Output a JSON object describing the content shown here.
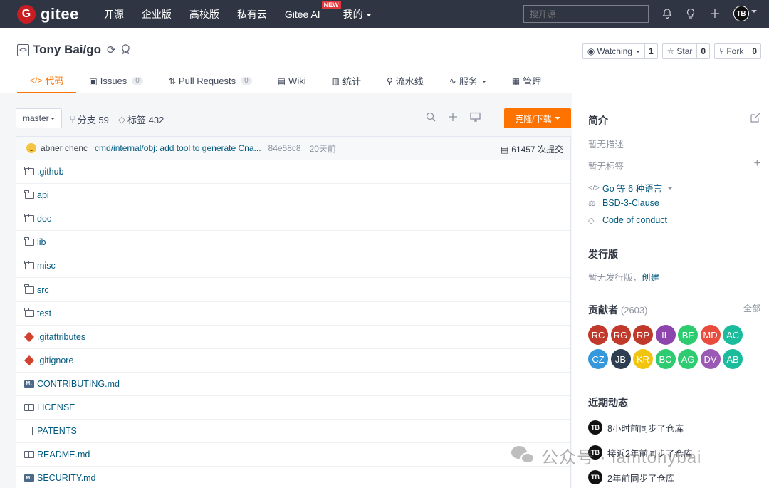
{
  "topnav": {
    "logo_mark": "G",
    "logo_text": "gitee",
    "items": [
      "开源",
      "企业版",
      "高校版",
      "私有云",
      "Gitee AI"
    ],
    "new_badge": "NEW",
    "mine": "我的",
    "search_placeholder": "搜开源",
    "avatar": "TB"
  },
  "repo": {
    "name": "Tony Bai/go",
    "watch_label": "Watching",
    "watch_count": "1",
    "star_label": "Star",
    "star_count": "0",
    "fork_label": "Fork",
    "fork_count": "0"
  },
  "tabs": {
    "code": "代码",
    "issues": "Issues",
    "issues_count": "0",
    "pulls": "Pull Requests",
    "pulls_count": "0",
    "wiki": "Wiki",
    "stats": "统计",
    "pipeline": "流水线",
    "services": "服务",
    "manage": "管理"
  },
  "toolbar": {
    "branch": "master",
    "branches": "分支 59",
    "tags": "标签 432",
    "clone": "克隆/下载"
  },
  "commit": {
    "author": "abner chenc",
    "message": "cmd/internal/obj: add tool to generate Cna...",
    "hash": "84e58c8",
    "time": "20天前",
    "count": "61457 次提交"
  },
  "files": [
    {
      "name": ".github",
      "type": "folder"
    },
    {
      "name": "api",
      "type": "folder"
    },
    {
      "name": "doc",
      "type": "folder"
    },
    {
      "name": "lib",
      "type": "folder"
    },
    {
      "name": "misc",
      "type": "folder"
    },
    {
      "name": "src",
      "type": "folder"
    },
    {
      "name": "test",
      "type": "folder"
    },
    {
      "name": ".gitattributes",
      "type": "git"
    },
    {
      "name": ".gitignore",
      "type": "git"
    },
    {
      "name": "CONTRIBUTING.md",
      "type": "md"
    },
    {
      "name": "LICENSE",
      "type": "book"
    },
    {
      "name": "PATENTS",
      "type": "doc"
    },
    {
      "name": "README.md",
      "type": "book"
    },
    {
      "name": "SECURITY.md",
      "type": "md"
    }
  ],
  "sidebar": {
    "intro_title": "简介",
    "no_desc": "暂无描述",
    "no_tags": "暂无标签",
    "language": "Go 等 6 种语言",
    "license": "BSD-3-Clause",
    "conduct": "Code of conduct",
    "release_title": "发行版",
    "no_release": "暂无发行版，",
    "create": "创建",
    "contrib_title": "贡献者",
    "contrib_count": "(2603)",
    "all": "全部",
    "contributors": [
      {
        "initials": "RC",
        "color": "#c0392b"
      },
      {
        "initials": "RG",
        "color": "#c0392b"
      },
      {
        "initials": "RP",
        "color": "#c0392b"
      },
      {
        "initials": "IL",
        "color": "#8e44ad"
      },
      {
        "initials": "BF",
        "color": "#2ecc71"
      },
      {
        "initials": "MD",
        "color": "#e74c3c"
      },
      {
        "initials": "AC",
        "color": "#1abc9c"
      },
      {
        "initials": "CZ",
        "color": "#3498db"
      },
      {
        "initials": "JB",
        "color": "#2c3e50"
      },
      {
        "initials": "KR",
        "color": "#f1c40f"
      },
      {
        "initials": "BC",
        "color": "#2ecc71"
      },
      {
        "initials": "AG",
        "color": "#2ecc71"
      },
      {
        "initials": "DV",
        "color": "#9b59b6"
      },
      {
        "initials": "AB",
        "color": "#1abc9c"
      }
    ],
    "activity_title": "近期动态",
    "activities": [
      "8小时前同步了仓库",
      "接近2年前同步了仓库",
      "2年前同步了仓库"
    ]
  },
  "watermark": "公众号 · iamtonybai"
}
